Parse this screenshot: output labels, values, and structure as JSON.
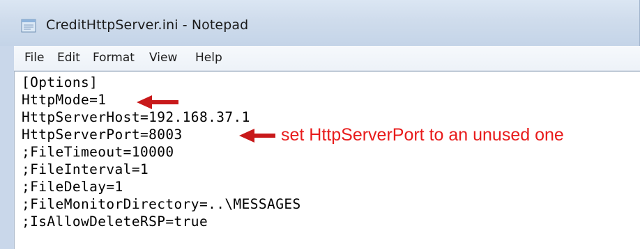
{
  "window": {
    "title": "CreditHttpServer.ini - Notepad",
    "icon": "notepad-icon"
  },
  "menu": {
    "items": [
      "File",
      "Edit",
      "Format",
      "View",
      "Help"
    ]
  },
  "editor": {
    "lines": [
      "[Options]",
      "HttpMode=1",
      "HttpServerHost=192.168.37.1",
      "HttpServerPort=8003",
      ";FileTimeout=10000",
      ";FileInterval=1",
      ";FileDelay=1",
      ";FileMonitorDirectory=..\\MESSAGES",
      ";IsAllowDeleteRSP=true"
    ]
  },
  "annotations": {
    "port_note": "set HttpServerPort to an unused one",
    "arrow_color": "#c8191a",
    "text_color": "#e81b1b"
  },
  "colors": {
    "titlebar": "#cfdcec",
    "menubar": "#f3f6fa",
    "editor_bg": "#ffffff"
  }
}
